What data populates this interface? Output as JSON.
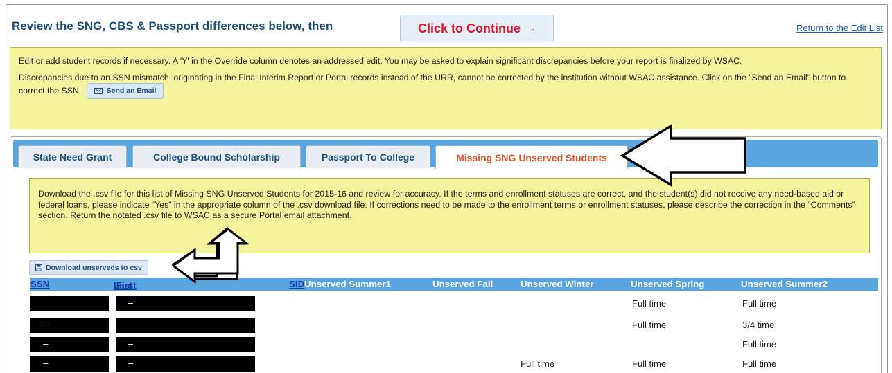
{
  "header": {
    "title": "Review the SNG, CBS & Passport differences below, then",
    "continue_label": "Click to Continue",
    "continue_arrow": "→",
    "return_link": "Return to the Edit List"
  },
  "notice": {
    "paragraph1": "Edit or add student records if necessary. A 'Y' in the Override column denotes an addressed edit. You may be asked to explain significant discrepancies before your report is finalized by WSAC.",
    "paragraph2": "Discrepancies due to an SSN mismatch, originating in the Final Interim Report or Portal records instead of the URR, cannot be corrected by the institution without WSAC assistance. Click on the \"Send an Email\" button to correct the SSN:",
    "email_button": "Send an Email",
    "email_icon": "envelope-icon"
  },
  "tabs": [
    {
      "label": "State Need Grant"
    },
    {
      "label": "College Bound Scholarship"
    },
    {
      "label": "Passport To College"
    },
    {
      "label": "Missing SNG Unserved Students"
    }
  ],
  "active_tab": "Missing SNG Unserved Students",
  "instructions": "Download the .csv file for this list of Missing SNG Unserved Students for 2015-16 and review for accuracy. If the terms and enrollment statuses are correct, and the student(s) did not receive any need-based aid or federal loans, please indicate “Yes” in the appropriate column of the .csv download file. If corrections need to be made to the enrollment terms or enrollment statuses, please describe the correction in the “Comments” section. Return the notated .csv file to WSAC as a secure Portal email attachment.",
  "download": {
    "label": "Download unserveds to csv",
    "icon": "download-icon"
  },
  "table": {
    "headers": {
      "ssn": "SSN",
      "last": "Last",
      "first": "First",
      "sid": "SID",
      "summer1": "Unserved Summer1",
      "fall": "Unserved Fall",
      "winter": "Unserved Winter",
      "spring": "Unserved Spring",
      "summer2": "Unserved Summer2"
    },
    "rows": [
      {
        "ssn": "",
        "name": "–",
        "summer1": "",
        "fall": "",
        "winter": "",
        "spring": "Full time",
        "summer2": "Full time"
      },
      {
        "ssn": "–",
        "name": "",
        "summer1": "",
        "fall": "",
        "winter": "",
        "spring": "Full time",
        "summer2": "3/4 time"
      },
      {
        "ssn": "–",
        "name": "–",
        "summer1": "",
        "fall": "",
        "winter": "",
        "spring": "",
        "summer2": "Full time"
      },
      {
        "ssn": "–",
        "name": "–",
        "summer1": "",
        "fall": "",
        "winter": "Full time",
        "spring": "Full time",
        "summer2": "Full time"
      }
    ]
  },
  "colors": {
    "accent_blue": "#5aa4df",
    "notice_yellow": "#f5f5a0",
    "continue_red": "#e0142a",
    "active_tab_orange": "#e2522a"
  }
}
